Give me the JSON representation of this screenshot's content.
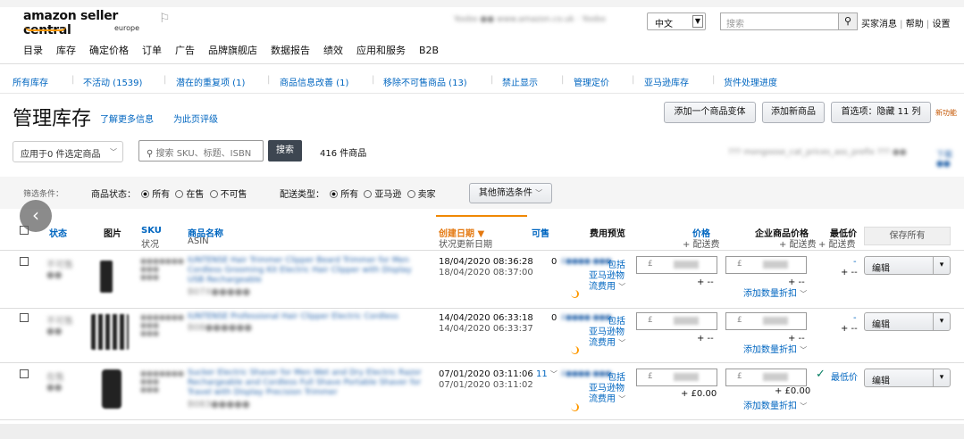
{
  "header": {
    "logo_main": "amazon seller central",
    "logo_sub": "europe",
    "account_blur": "Yoobo ●● www.amazon.co.uk · Yoobo",
    "language": "中文",
    "search_placeholder": "搜索",
    "links": [
      "买家消息",
      "帮助",
      "设置"
    ]
  },
  "main_nav": [
    "目录",
    "库存",
    "确定价格",
    "订单",
    "广告",
    "品牌旗舰店",
    "数据报告",
    "绩效",
    "应用和服务",
    "B2B"
  ],
  "sub_nav": [
    "所有库存",
    "不活动 (1539)",
    "潜在的重复项 (1)",
    "商品信息改善 (1)",
    "移除不可售商品 (13)",
    "禁止显示",
    "管理定价",
    "亚马逊库存",
    "货件处理进度"
  ],
  "page": {
    "title": "管理库存",
    "learn_more": "了解更多信息",
    "rate_page": "为此页评级",
    "add_variant": "添加一个商品变体",
    "add_product": "添加新商品",
    "preferences": "首选项：隐藏 11 列",
    "new_feature": "新功能"
  },
  "toolbar": {
    "apply_to": "应用于0 件选定商品",
    "sku_placeholder": "搜索 SKU、标题、ISBN",
    "search_button": "搜索",
    "count": "416 件商品",
    "right_blur": "??? mongoose_cat_prices_ass_prefix ??? ●●",
    "right_blur2": "下载 ●●"
  },
  "filters": {
    "label": "筛选条件：",
    "status_label": "商品状态：",
    "status_options": [
      "所有",
      "在售",
      "不可售"
    ],
    "ship_label": "配送类型：",
    "ship_options": [
      "所有",
      "亚马逊",
      "卖家"
    ],
    "more": "其他筛选条件"
  },
  "columns": {
    "status": "状态",
    "image": "图片",
    "sku": "SKU",
    "sku_sub": "状况",
    "name": "商品名称",
    "name_sub": "ASIN",
    "created": "创建日期",
    "created_sub": "状况更新日期",
    "available": "可售",
    "fee": "费用预览",
    "price": "价格",
    "price_sub": "+ 配送费",
    "biz_price": "企业商品价格",
    "biz_price_sub": "+ 配送费",
    "min_price": "最低价",
    "min_price_sub": "+ 配送费",
    "save_all": "保存所有"
  },
  "rows": [
    {
      "status": "不可售 ●●",
      "sku": "●●●●●●● ●●● ●●●",
      "name": "IUNTENSE Hair Trimmer Clipper Beard Trimmer for Men Cordless Grooming Kit Electric Hair Clipper with Display USB Rechargeable",
      "asin": "B07X●●●●●",
      "created": "18/04/2020 08:36:28",
      "updated": "18/04/2020 08:37:00",
      "available": "0",
      "fee_blur": "£●●●● ●●●",
      "fee_incl": "包括",
      "fee_amazon": "亚马逊物",
      "fee_flow": "流费用",
      "price_symbol": "£",
      "price_plus": "+ --",
      "biz_symbol": "£",
      "biz_plus": "+ --",
      "qty_discount": "添加数量折扣",
      "min_price": "-",
      "min_plus": "+ --",
      "edit": "编辑"
    },
    {
      "status": "不可售 ●●",
      "sku": "●●●●●●● ●●● ●●●",
      "name": "IUNTENSE Professional Hair Clipper Electric Cordless",
      "asin": "B08●●●●●●",
      "created": "14/04/2020 06:33:18",
      "updated": "14/04/2020 06:33:37",
      "available": "0",
      "fee_blur": "£●●●● ●●●",
      "fee_incl": "包括",
      "fee_amazon": "亚马逊物",
      "fee_flow": "流费用",
      "price_symbol": "£",
      "price_plus": "+ --",
      "biz_symbol": "£",
      "biz_plus": "+ --",
      "qty_discount": "添加数量折扣",
      "min_price": "-",
      "min_plus": "+ --",
      "edit": "编辑"
    },
    {
      "status": "在售 ●●",
      "sku": "●●●●●●● ●●● ●●●",
      "name": "Sucker Electric Shaver for Men Wet and Dry Electric Razor Rechargeable and Cordless Full Shave Portable Shaver for Travel with Display Precision Trimmer",
      "asin": "B083●●●●●",
      "created": "07/01/2020 03:11:06",
      "updated": "07/01/2020 03:11:02",
      "available": "11",
      "fee_blur": "£●●●● ●●●",
      "fee_incl": "包括",
      "fee_amazon": "亚马逊物",
      "fee_flow": "流费用",
      "price_symbol": "£",
      "price_plus": "+ £0.00",
      "biz_symbol": "£",
      "biz_plus": "+ £0.00",
      "qty_discount": "添加数量折扣",
      "min_price": "最低价",
      "min_plus": "",
      "edit": "编辑"
    }
  ]
}
